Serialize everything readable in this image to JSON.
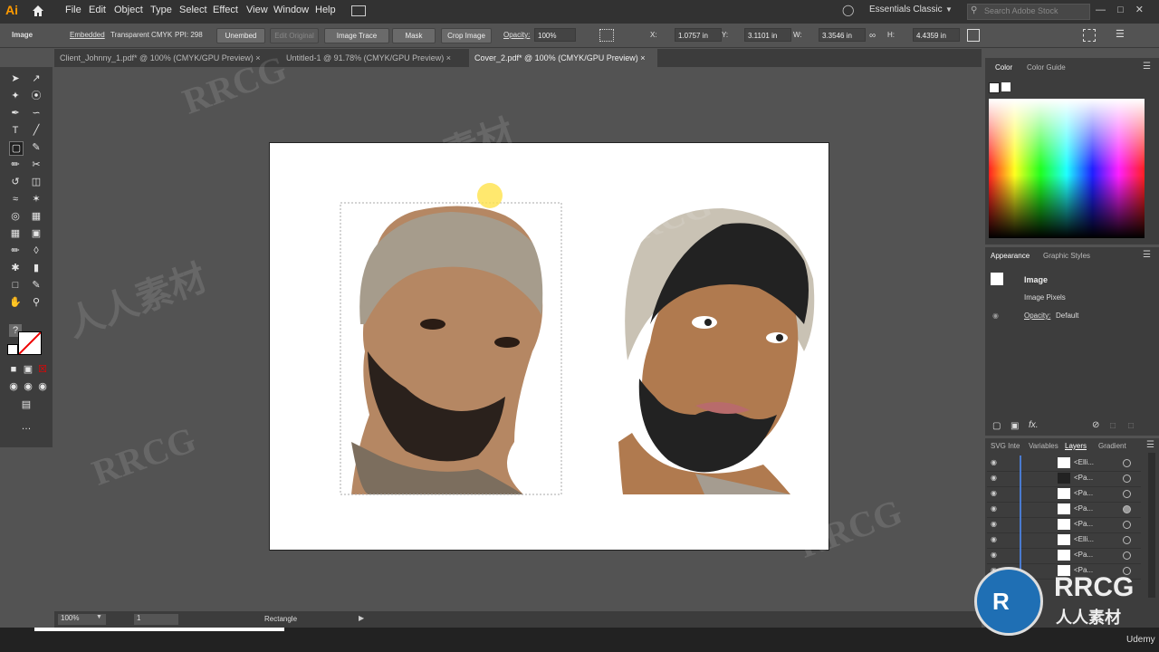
{
  "app": {
    "logo": "Ai"
  },
  "menu": [
    "File",
    "Edit",
    "Object",
    "Type",
    "Select",
    "Effect",
    "View",
    "Window",
    "Help"
  ],
  "workspace": "Essentials Classic",
  "search_placeholder": "Search Adobe Stock",
  "control_bar": {
    "object_type": "Image",
    "embedded": "Embedded",
    "color_mode": "Transparent CMYK",
    "ppi": "PPI: 298",
    "unembed": "Unembed",
    "edit_original": "Edit Original",
    "image_trace": "Image Trace",
    "mask": "Mask",
    "crop_image": "Crop Image",
    "opacity_label": "Opacity:",
    "opacity_value": "100%",
    "x_label": "X:",
    "x_value": "1.0757 in",
    "y_label": "Y:",
    "y_value": "3.1101 in",
    "w_label": "W:",
    "w_value": "3.3546 in",
    "h_label": "H:",
    "h_value": "4.4359 in"
  },
  "tabs": [
    {
      "label": "Client_Johnny_1.pdf* @ 100% (CMYK/GPU Preview)"
    },
    {
      "label": "Untitled-1 @ 91.78% (CMYK/GPU Preview)"
    },
    {
      "label": "Cover_2.pdf* @ 100% (CMYK/GPU Preview)"
    }
  ],
  "color_panel": {
    "tabs": [
      "Color",
      "Color Guide"
    ]
  },
  "appearance_panel": {
    "tabs": [
      "Appearance",
      "Graphic Styles"
    ],
    "item": "Image",
    "sub": "Image Pixels",
    "opacity_label": "Opacity:",
    "opacity_value": "Default"
  },
  "layers_panel": {
    "tabs": [
      "SVG Inte",
      "Variables",
      "Layers",
      "Gradient"
    ],
    "rows": [
      "<Elli...",
      "<Pa...",
      "<Pa...",
      "<Pa...",
      "<Pa...",
      "<Elli...",
      "<Pa...",
      "<Pa..."
    ]
  },
  "status": {
    "zoom": "100%",
    "artboard": "1",
    "tool": "Rectangle"
  },
  "watermarks": [
    "RRCG",
    "人人素材",
    "RRCG",
    "人人素材",
    "RRCG",
    "RRCG"
  ],
  "brand": {
    "badge": "RRCG",
    "sub": "人人素材",
    "udemy": "Udemy"
  },
  "colors": {
    "accent": "#4a7bd0",
    "skin": "#b07a4f",
    "beard": "#222222",
    "beanie": "#c9c2b4"
  }
}
